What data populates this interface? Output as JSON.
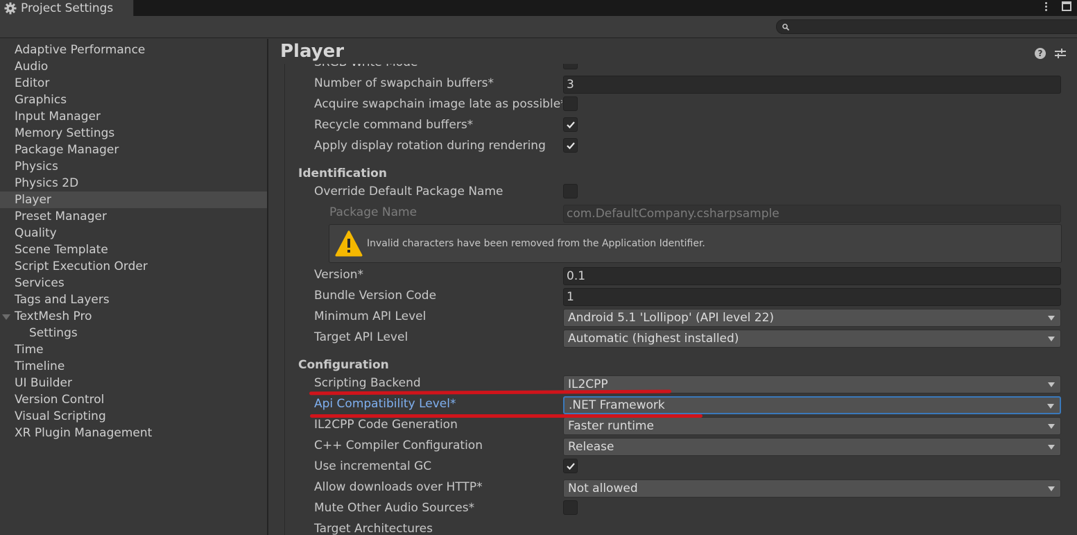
{
  "window": {
    "tab_title": "Project Settings"
  },
  "sidebar": {
    "items": [
      {
        "label": "Adaptive Performance"
      },
      {
        "label": "Audio"
      },
      {
        "label": "Editor"
      },
      {
        "label": "Graphics"
      },
      {
        "label": "Input Manager"
      },
      {
        "label": "Memory Settings"
      },
      {
        "label": "Package Manager"
      },
      {
        "label": "Physics"
      },
      {
        "label": "Physics 2D"
      },
      {
        "label": "Player",
        "selected": true
      },
      {
        "label": "Preset Manager"
      },
      {
        "label": "Quality"
      },
      {
        "label": "Scene Template"
      },
      {
        "label": "Script Execution Order"
      },
      {
        "label": "Services"
      },
      {
        "label": "Tags and Layers"
      },
      {
        "label": "TextMesh Pro",
        "expanded": true
      },
      {
        "label": "Settings",
        "child": true
      },
      {
        "label": "Time"
      },
      {
        "label": "Timeline"
      },
      {
        "label": "UI Builder"
      },
      {
        "label": "Version Control"
      },
      {
        "label": "Visual Scripting"
      },
      {
        "label": "XR Plugin Management"
      }
    ]
  },
  "main": {
    "title": "Player",
    "rows": {
      "srgb_write_mode": "SRGB Write Mode",
      "swapchain_buffers": {
        "label": "Number of swapchain buffers*",
        "value": "3"
      },
      "acquire_late": {
        "label": "Acquire swapchain image late as possible*",
        "checked": false
      },
      "recycle_buffers": {
        "label": "Recycle command buffers*",
        "checked": true
      },
      "display_rotation": {
        "label": "Apply display rotation during rendering",
        "checked": true
      }
    },
    "identification": {
      "header": "Identification",
      "override_package": {
        "label": "Override Default Package Name",
        "checked": false
      },
      "package_name": {
        "label": "Package Name",
        "value": "com.DefaultCompany.csharpsample"
      },
      "warning": "Invalid characters have been removed from the Application Identifier.",
      "version": {
        "label": "Version*",
        "value": "0.1"
      },
      "bundle_code": {
        "label": "Bundle Version Code",
        "value": "1"
      },
      "min_api": {
        "label": "Minimum API Level",
        "value": "Android 5.1 'Lollipop' (API level 22)"
      },
      "target_api": {
        "label": "Target API Level",
        "value": "Automatic (highest installed)"
      }
    },
    "configuration": {
      "header": "Configuration",
      "scripting_backend": {
        "label": "Scripting Backend",
        "value": "IL2CPP"
      },
      "api_compat": {
        "label": "Api Compatibility Level*",
        "value": ".NET Framework"
      },
      "il2cpp_codegen": {
        "label": "IL2CPP Code Generation",
        "value": "Faster runtime"
      },
      "cpp_compiler": {
        "label": "C++ Compiler Configuration",
        "value": "Release"
      },
      "incremental_gc": {
        "label": "Use incremental GC",
        "checked": true
      },
      "http_downloads": {
        "label": "Allow downloads over HTTP*",
        "value": "Not allowed"
      },
      "mute_audio": {
        "label": "Mute Other Audio Sources*",
        "checked": false
      },
      "target_arch": "Target Architectures"
    }
  },
  "colors": {
    "annotation_red": "#d0141b",
    "focus_blue": "#3a79bb",
    "active_label": "#7fb0f0"
  }
}
